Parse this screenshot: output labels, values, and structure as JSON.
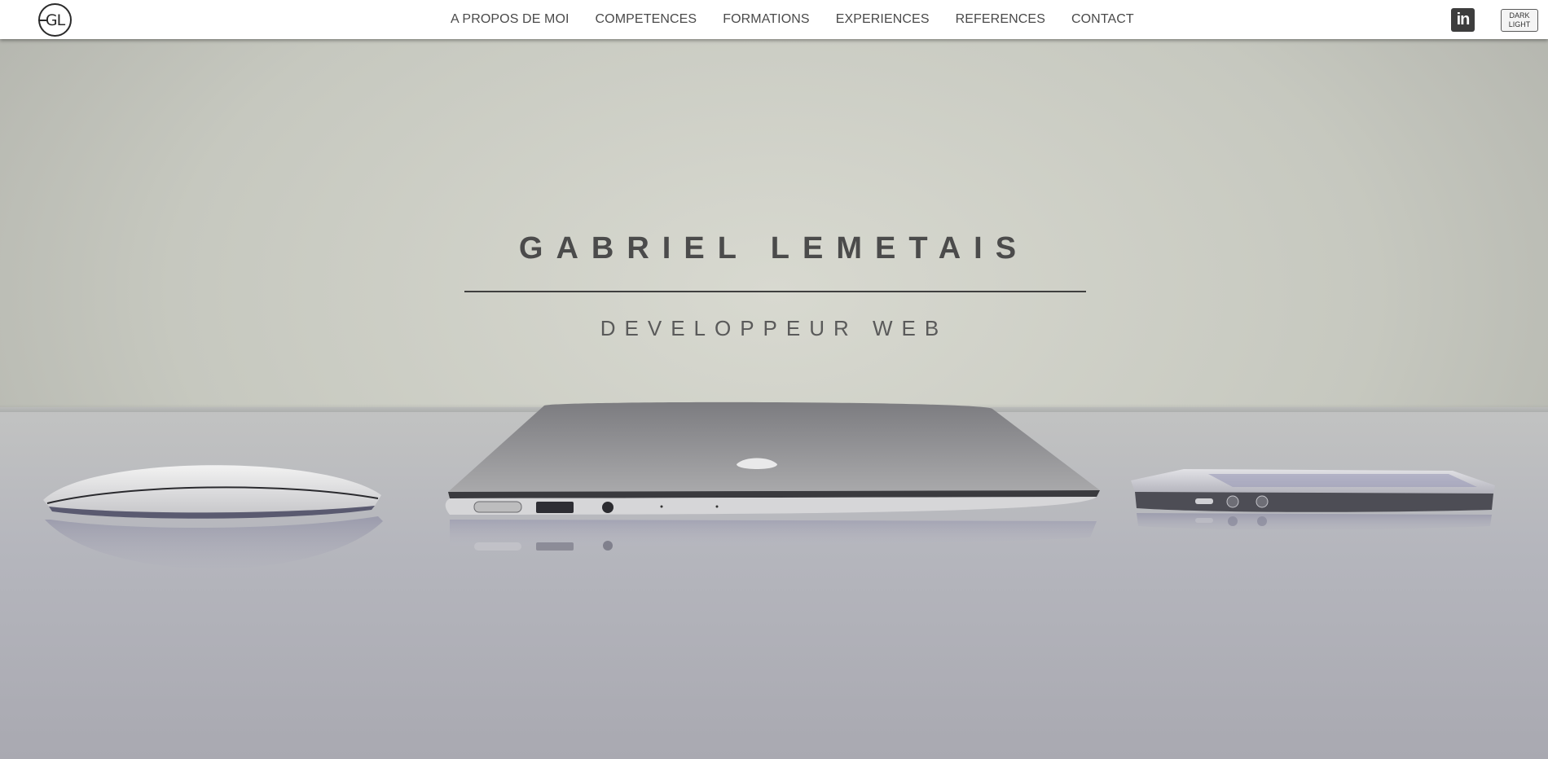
{
  "nav": {
    "logo_text": "GL",
    "links": [
      "A PROPOS DE MOI",
      "COMPETENCES",
      "FORMATIONS",
      "EXPERIENCES",
      "REFERENCES",
      "CONTACT"
    ],
    "linkedin_label": "in",
    "theme_toggle": {
      "line1": "DARK",
      "line2": "LIGHT"
    }
  },
  "hero": {
    "title": "GABRIEL LEMETAIS",
    "subtitle": "DEVELOPPEUR WEB",
    "background_icons": [
      "mouse-icon",
      "laptop-icon",
      "phone-icon"
    ]
  },
  "colors": {
    "navbar_bg": "#ffffff",
    "text_dark": "#4b4b4b",
    "hero_bg": "#c6c8bf"
  }
}
